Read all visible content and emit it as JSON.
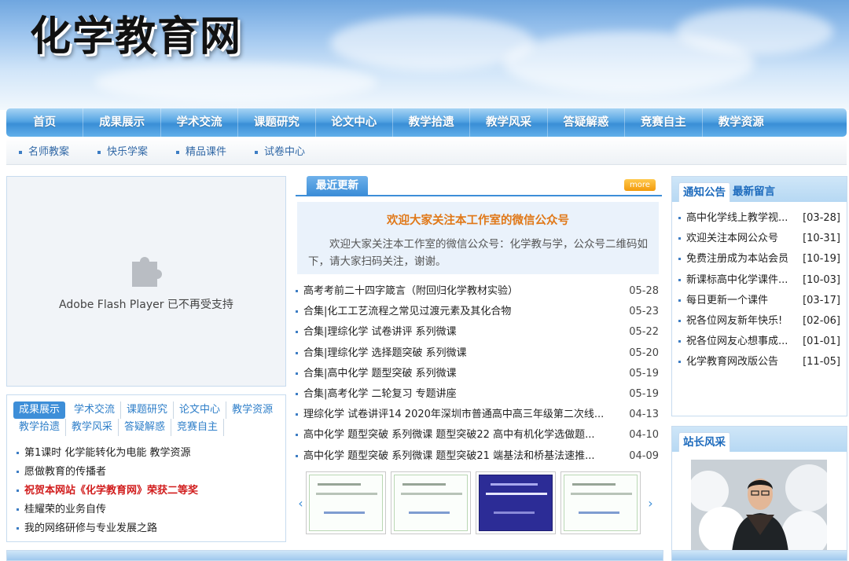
{
  "site": {
    "logo": "化学教育网"
  },
  "nav": [
    "首页",
    "成果展示",
    "学术交流",
    "课题研究",
    "论文中心",
    "教学拾遗",
    "教学风采",
    "答疑解惑",
    "竞赛自主",
    "教学资源"
  ],
  "subnav": [
    "名师教案",
    "快乐学案",
    "精品课件",
    "试卷中心"
  ],
  "flash": {
    "message": "Adobe Flash Player 已不再受支持",
    "icon": "puzzle-piece-icon"
  },
  "left_tabs": [
    "成果展示",
    "学术交流",
    "课题研究",
    "论文中心",
    "教学资源",
    "教学拾遗",
    "教学风采",
    "答疑解惑",
    "竞赛自主"
  ],
  "left_list": [
    {
      "text": "第1课时 化学能转化为电能 教学资源",
      "highlight": false
    },
    {
      "text": "愿做教育的传播者",
      "highlight": false
    },
    {
      "text": "祝贺本网站《化学教育网》荣获二等奖",
      "highlight": true
    },
    {
      "text": "桂耀荣的业务自传",
      "highlight": false
    },
    {
      "text": "我的网络研修与专业发展之路",
      "highlight": false
    }
  ],
  "center": {
    "title": "最近更新",
    "more_label": "more",
    "featured": {
      "title": "欢迎大家关注本工作室的微信公众号",
      "desc": "欢迎大家关注本工作室的微信公众号：化学教与学，公众号二维码如下，请大家扫码关注，谢谢。"
    },
    "list": [
      {
        "title": "高考考前二十四字箴言（附回归化学教材实验）",
        "date": "05-28"
      },
      {
        "title": "合集|化工工艺流程之常见过渡元素及其化合物",
        "date": "05-23"
      },
      {
        "title": "合集|理综化学 试卷讲评 系列微课",
        "date": "05-22"
      },
      {
        "title": "合集|理综化学 选择题突破 系列微课",
        "date": "05-20"
      },
      {
        "title": "合集|高中化学 题型突破 系列微课",
        "date": "05-19"
      },
      {
        "title": "合集|高考化学 二轮复习 专题讲座",
        "date": "05-19"
      },
      {
        "title": "理综化学 试卷讲评14 2020年深圳市普通高中高三年级第二次线...",
        "date": "04-13"
      },
      {
        "title": "高中化学 题型突破 系列微课 题型突破22 高中有机化学选做题...",
        "date": "04-10"
      },
      {
        "title": "高中化学 题型突破 系列微课 题型突破21 端基法和桥基法速推...",
        "date": "04-09"
      }
    ]
  },
  "notice": {
    "tabs": [
      "通知公告",
      "最新留言"
    ],
    "list": [
      {
        "title": "高中化学线上教学视...",
        "date": "[03-28]"
      },
      {
        "title": "欢迎关注本网公众号",
        "date": "[10-31]"
      },
      {
        "title": "免费注册成为本站会员",
        "date": "[10-19]"
      },
      {
        "title": "新课标高中化学课件...",
        "date": "[10-03]"
      },
      {
        "title": "每日更新一个课件",
        "date": "[03-17]"
      },
      {
        "title": "祝各位网友新年快乐!",
        "date": "[02-06]"
      },
      {
        "title": "祝各位网友心想事成...",
        "date": "[01-01]"
      },
      {
        "title": "化学教育网改版公告",
        "date": "[11-05]"
      }
    ]
  },
  "webmaster": {
    "title": "站长风采"
  }
}
